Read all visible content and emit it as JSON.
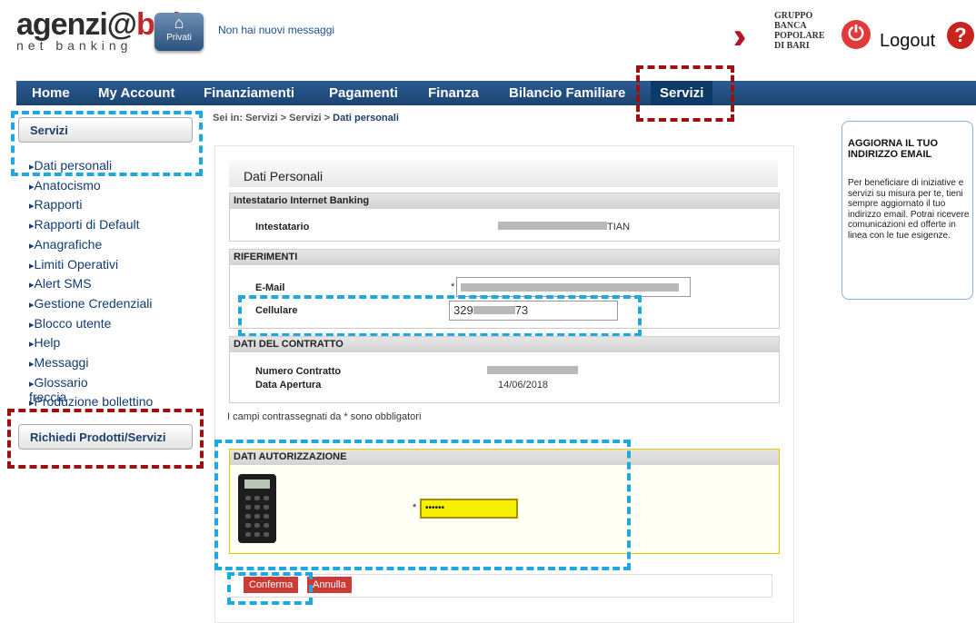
{
  "header": {
    "logo_main": "agenzi@",
    "logo_brand": "bpb",
    "logo_sub": "net banking",
    "privati_label": "Privati",
    "messages": "Non hai nuovi messaggi",
    "bank_name_lines": [
      "GRUPPO",
      "BANCA",
      "POPOLARE",
      "DI BARI"
    ],
    "logout": "Logout"
  },
  "nav": {
    "items": [
      "Home",
      "My Account",
      "Finanziamenti",
      "Pagamenti",
      "Finanza",
      "Bilancio Familiare",
      "Servizi"
    ],
    "active": "Servizi"
  },
  "sidebar": {
    "section_title": "Servizi",
    "items": [
      "Dati personali",
      "Anatocismo",
      "Rapporti",
      "Rapporti di Default",
      "Anagrafiche",
      "Limiti Operativi",
      "Alert SMS",
      "Gestione Credenziali",
      "Blocco utente",
      "Help",
      "Messaggi",
      "Glossario",
      "Produzione bollettino",
      "freccia"
    ],
    "request_button": "Richiedi Prodotti/Servizi"
  },
  "breadcrumb": {
    "prefix": "Sei in:",
    "items": [
      "Servizi",
      "Servizi"
    ],
    "current": "Dati personali",
    "separator": ">"
  },
  "main": {
    "title": "Dati Personali",
    "sec_intestatario": "Intestatario Internet Banking",
    "intestatario_label": "Intestatario",
    "intestatario_value_tail": "TIAN",
    "sec_riferimenti": "RIFERIMENTI",
    "email_label": "E-Mail",
    "cellulare_label": "Cellulare",
    "cellulare_prefix": "329",
    "cellulare_suffix": "73",
    "sec_contratto": "DATI DEL CONTRATTO",
    "numero_label": "Numero Contratto",
    "apertura_label": "Data Apertura",
    "apertura_value": "14/06/2018",
    "required_note": "I campi contrassegnati da * sono obbligatori",
    "sec_autorizzazione": "DATI AUTORIZZAZIONE",
    "password_mask": "••••••",
    "required_star": "*",
    "confirm": "Conferma",
    "cancel": "Annulla"
  },
  "promo": {
    "heading": "AGGIORNA IL TUO INDIRIZZO EMAIL",
    "body": "Per beneficiare di iniziative e servizi su misura per te, tieni sempre aggiornato il tuo indirizzo email. Potrai ricevere comunicazioni ed offerte in linea con le tue esigenze."
  },
  "colors": {
    "nav": "#1c4470",
    "highlight_blue": "#1fa7e0",
    "highlight_red": "#a01010",
    "button": "#cc3b35",
    "password_bg": "#f6f000"
  }
}
